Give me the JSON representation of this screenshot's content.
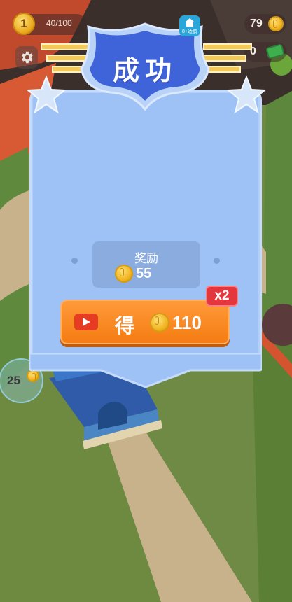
{
  "hud": {
    "level": "1",
    "level_progress": "40/100",
    "level_progress_fraction": 0.4,
    "coins": "79",
    "cash": "0",
    "age_badge": "8+适龄"
  },
  "dialog": {
    "title": "成功",
    "reward_label": "奖励",
    "reward_amount": "55",
    "get_label": "得",
    "get_amount": "110",
    "multiplier": "x2"
  },
  "map": {
    "plot_marker_value": "25"
  },
  "colors": {
    "panel": "#9fc2f6",
    "banner": "#3f63d8",
    "button": "#f57c12",
    "multiplier": "#e4363d",
    "coin": "#f0b21c"
  },
  "icons": {
    "settings": "gear-icon",
    "video": "play-video-icon",
    "currency": "coin-icon",
    "cash": "cash-icon"
  }
}
